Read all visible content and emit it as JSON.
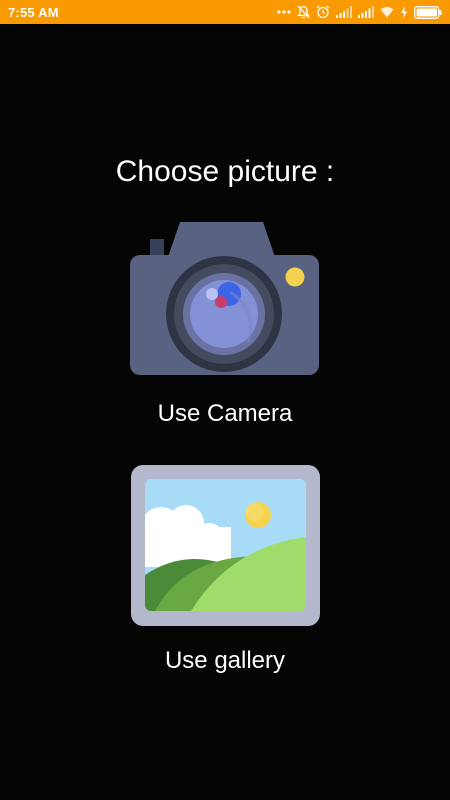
{
  "status_bar": {
    "time": "7:55 AM",
    "background": "#f99b00",
    "icons": [
      "more-dots-icon",
      "notifications-off-icon",
      "alarm-icon",
      "signal-icon",
      "signal-icon",
      "wifi-icon",
      "charging-icon",
      "battery-icon"
    ]
  },
  "main": {
    "title": "Choose picture :",
    "camera_label": "Use Camera",
    "gallery_label": "Use gallery"
  }
}
